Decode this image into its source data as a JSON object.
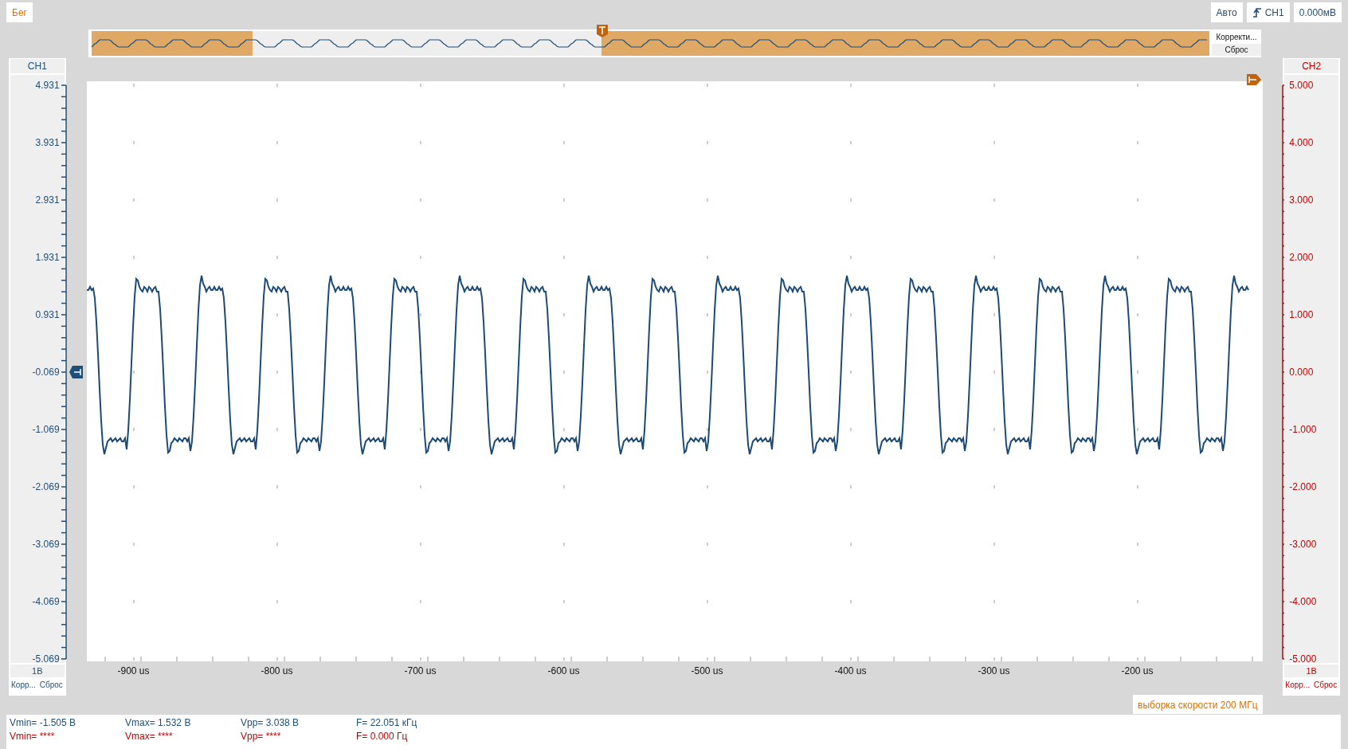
{
  "toolbar": {
    "run_button": "Бег",
    "trigger_mode": "Авто",
    "trigger_source": "CH1",
    "trigger_level": "0.000мВ"
  },
  "overview": {
    "buttons": [
      "Корректи...",
      "Сброс"
    ]
  },
  "channels": [
    {
      "name": "CH1",
      "color": "#1f4e79",
      "ticks": [
        "4.931",
        "3.931",
        "2.931",
        "1.931",
        "0.931",
        "-0.069",
        "-1.069",
        "-2.069",
        "-3.069",
        "-4.069",
        "-5.069"
      ],
      "scale": "1В",
      "buttons": [
        "Корр...",
        "Сброс"
      ]
    },
    {
      "name": "CH2",
      "color": "#c00000",
      "ticks": [
        "5.000",
        "4.000",
        "3.000",
        "2.000",
        "1.000",
        "0.000",
        "-1.000",
        "-2.000",
        "-3.000",
        "-4.000",
        "-5.000"
      ],
      "scale": "1В",
      "buttons": [
        "Корр...",
        "Сброс"
      ]
    }
  ],
  "x_axis": {
    "ticks": [
      "-900 us",
      "-800 us",
      "-700 us",
      "-600 us",
      "-500 us",
      "-400 us",
      "-300 us",
      "-200 us"
    ]
  },
  "sample_rate": "выборка скорости 200 МГц",
  "measurements": [
    {
      "vmin": "Vmin= -1.505 В",
      "vmax": "Vmax= 1.532 В",
      "vpp": "Vpp= 3.038 В",
      "f": "F= 22.051 кГц"
    },
    {
      "vmin": "Vmin= ****",
      "vmax": "Vmax= ****",
      "vpp": "Vpp= ****",
      "f": "F= 0.000 Гц"
    }
  ]
}
